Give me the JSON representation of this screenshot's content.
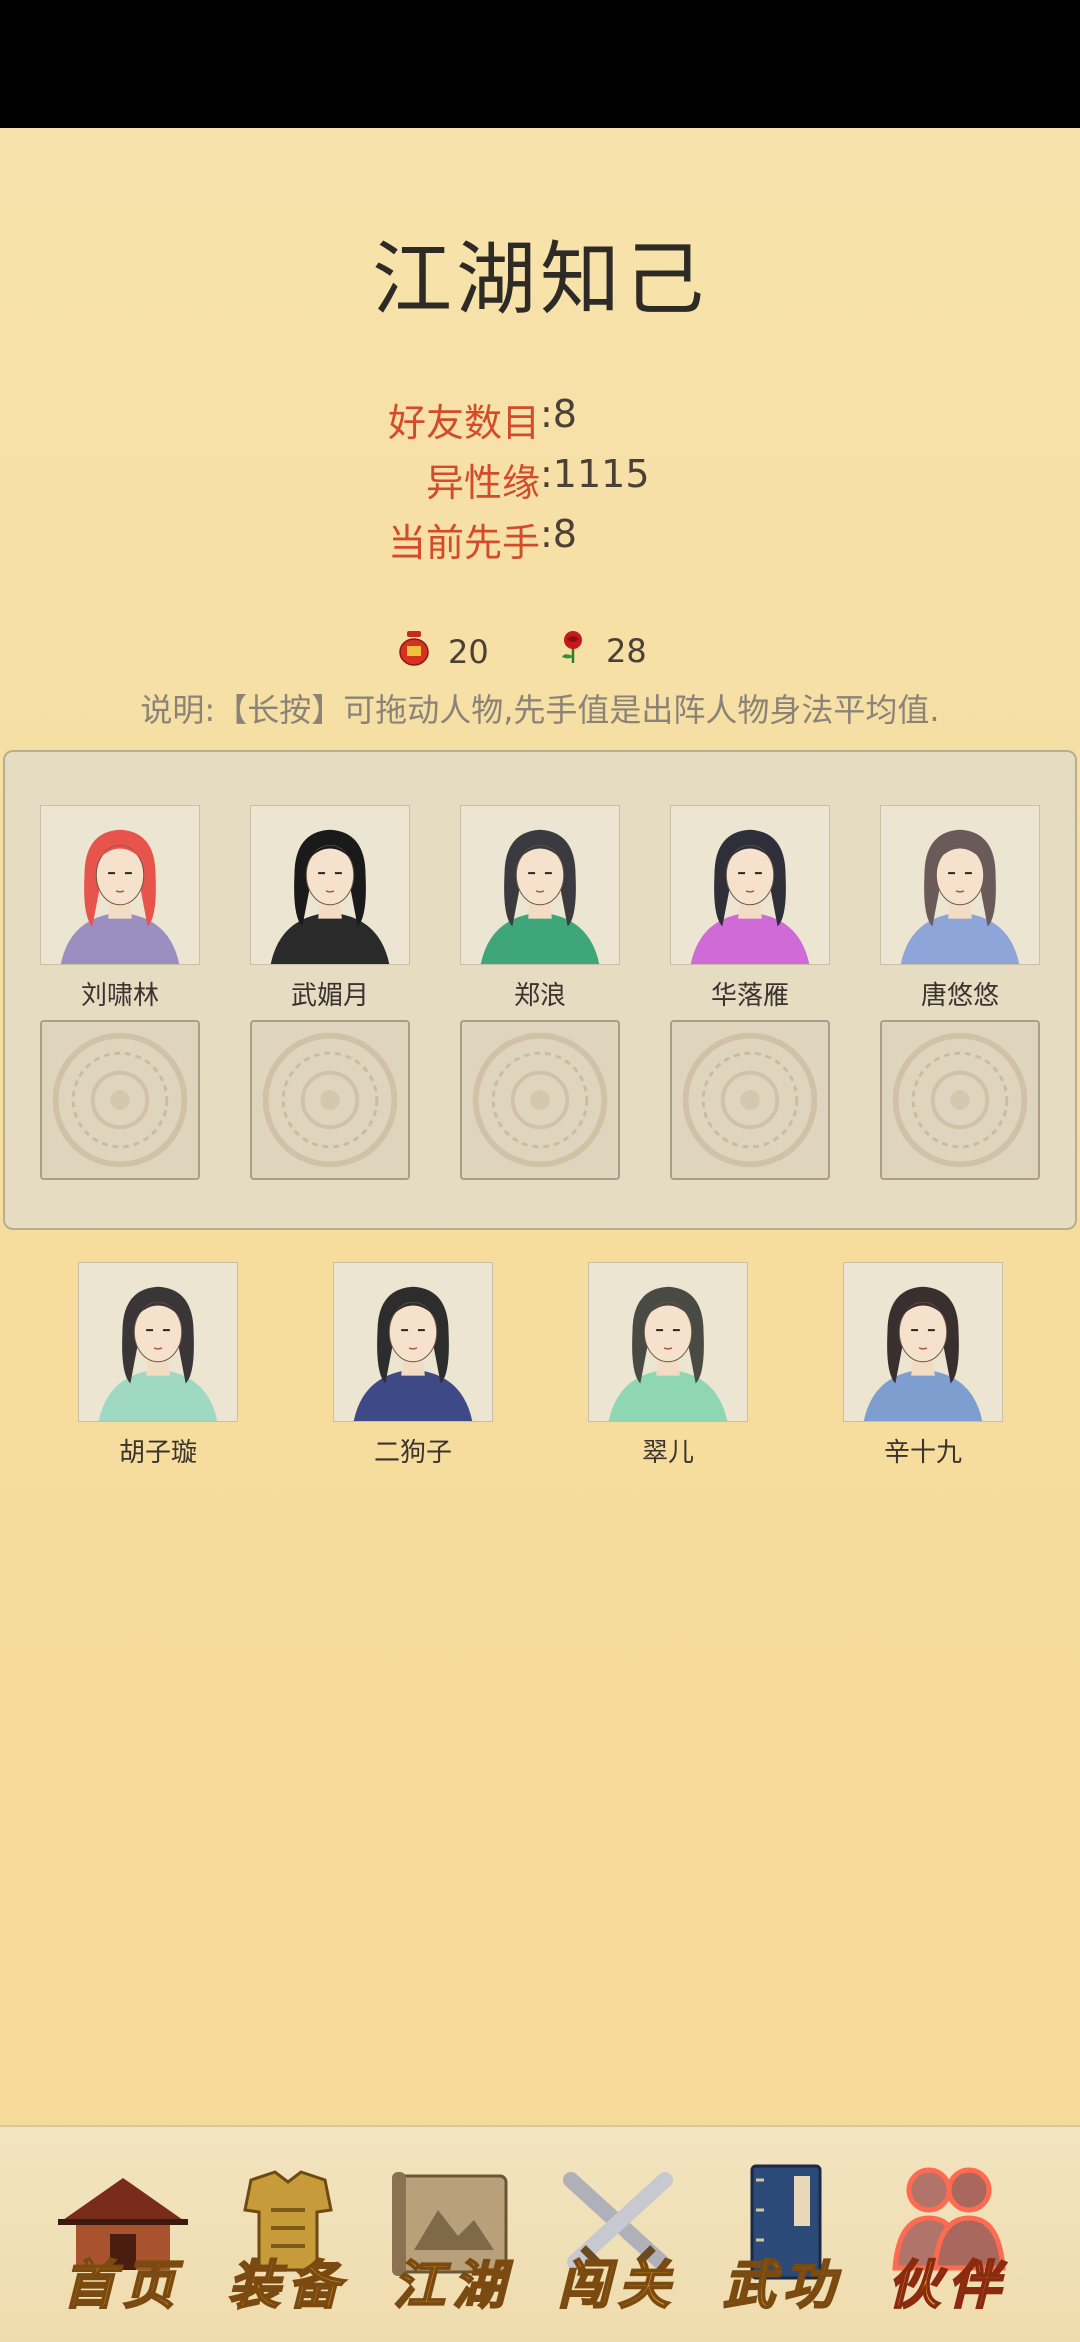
{
  "page": {
    "title": "江湖知己"
  },
  "stats": [
    {
      "label": "好友数目",
      "value": ":8"
    },
    {
      "label": "异性缘",
      "value": ":1115"
    },
    {
      "label": "当前先手",
      "value": ":8"
    }
  ],
  "currency": [
    {
      "icon": "wine-jar-icon",
      "value": "20"
    },
    {
      "icon": "rose-icon",
      "value": "28"
    }
  ],
  "note": "说明:【长按】可拖动人物,先手值是出阵人物身法平均值.",
  "team": [
    {
      "name": "刘啸林",
      "hair": "#e6544c",
      "robe": "#9a8fc0"
    },
    {
      "name": "武媚月",
      "hair": "#1a1a1a",
      "robe": "#2a2a2a"
    },
    {
      "name": "郑浪",
      "hair": "#3a3a40",
      "robe": "#3fa67a"
    },
    {
      "name": "华落雁",
      "hair": "#2f2f3a",
      "robe": "#d06ad6"
    },
    {
      "name": "唐悠悠",
      "hair": "#6a5a5a",
      "robe": "#8fa4d8"
    }
  ],
  "empty_slots": 5,
  "reserve": [
    {
      "name": "胡子璇",
      "hair": "#3a3536",
      "robe": "#9fd9c4"
    },
    {
      "name": "二狗子",
      "hair": "#2d2d2d",
      "robe": "#3d4a86"
    },
    {
      "name": "翠儿",
      "hair": "#4a4a44",
      "robe": "#8fd6b2"
    },
    {
      "name": "辛十九",
      "hair": "#3a2f2f",
      "robe": "#7f9ed0"
    }
  ],
  "nav": [
    {
      "label": "首页",
      "icon": "house-icon",
      "active": false
    },
    {
      "label": "装备",
      "icon": "armor-icon",
      "active": false
    },
    {
      "label": "江湖",
      "icon": "scroll-map-icon",
      "active": false
    },
    {
      "label": "闯关",
      "icon": "crossed-swords-icon",
      "active": false
    },
    {
      "label": "武功",
      "icon": "book-icon",
      "active": false
    },
    {
      "label": "伙伴",
      "icon": "partners-icon",
      "active": true
    }
  ],
  "colors": {
    "accent": "#d24c2c",
    "background": "#f6dda0",
    "nav_text": "#e0a520"
  }
}
